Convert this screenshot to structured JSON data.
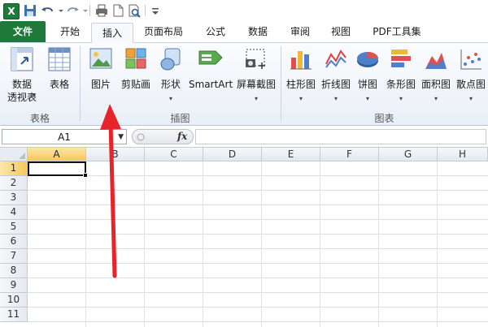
{
  "quick_access": {
    "app_icon": "excel-icon",
    "items": [
      "save-icon",
      "undo-icon",
      "redo-icon",
      "print-icon",
      "new-doc-icon",
      "print-preview-icon",
      "customize-icon"
    ]
  },
  "tabs": [
    {
      "label": "文件"
    },
    {
      "label": "开始"
    },
    {
      "label": "插入"
    },
    {
      "label": "页面布局"
    },
    {
      "label": "公式"
    },
    {
      "label": "数据"
    },
    {
      "label": "审阅"
    },
    {
      "label": "视图"
    },
    {
      "label": "PDF工具集"
    }
  ],
  "ribbon": {
    "groups": {
      "tables": "表格",
      "illustrations": "插图",
      "charts": "图表"
    },
    "buttons": {
      "pivot_line1": "数据",
      "pivot_line2": "透视表",
      "table": "表格",
      "picture": "图片",
      "clipart": "剪贴画",
      "shapes": "形状",
      "smartart": "SmartArt",
      "screenshot": "屏幕截图",
      "column": "柱形图",
      "line": "折线图",
      "pie": "饼图",
      "bar": "条形图",
      "area": "面积图",
      "scatter": "散点图"
    }
  },
  "formula_bar": {
    "name_box": "A1",
    "fx": "fx",
    "value": ""
  },
  "sheet": {
    "columns": [
      "A",
      "B",
      "C",
      "D",
      "E",
      "F",
      "G",
      "H"
    ],
    "rows": [
      "1",
      "2",
      "3",
      "4",
      "5",
      "6",
      "7",
      "8",
      "9",
      "10",
      "11"
    ],
    "selected_cell": "A1"
  },
  "colors": {
    "file_tab": "#1f7a3a",
    "annotation_arrow": "#e8242b",
    "selected_header": "#f5c85a"
  }
}
